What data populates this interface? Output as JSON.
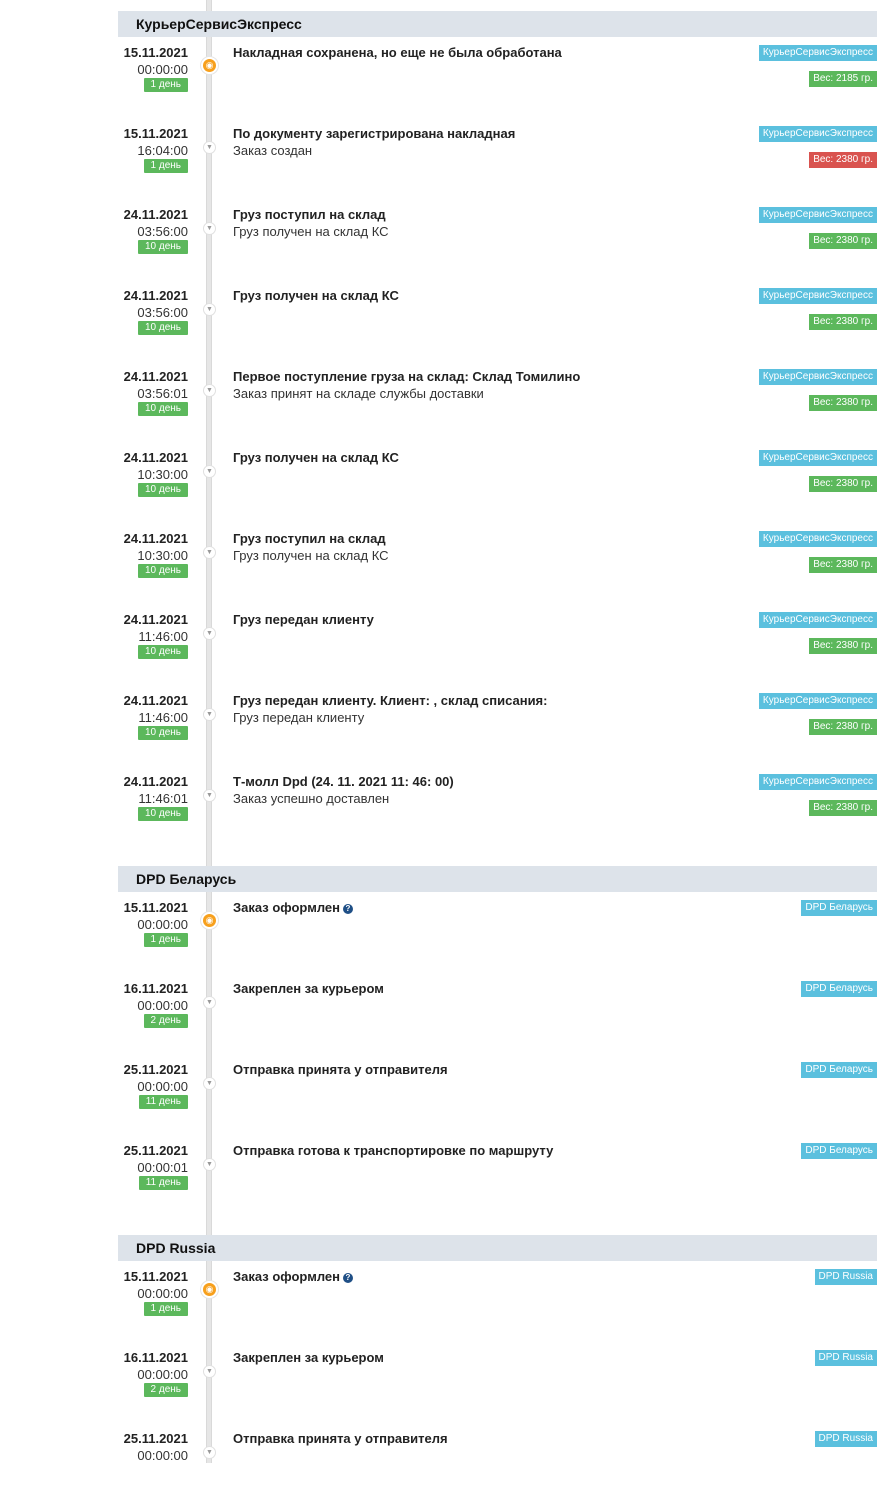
{
  "colors": {
    "days_badge": "#5cb85c",
    "source_badge": "#5bc0de",
    "weight_ok": "#5cb85c",
    "weight_warn": "#d9534f",
    "header_bg": "#dde3ea",
    "marker": "#f7a01d"
  },
  "icons": {
    "first_marker": "package-icon",
    "marker": "chevron-down-icon",
    "help": "question-circle-icon"
  },
  "groups": [
    {
      "title": "КурьерСервисЭкспресс",
      "events": [
        {
          "date": "15.11.2021",
          "time": "00:00:00",
          "days": "1 день",
          "title": "Накладная сохранена, но еще не была обработана",
          "subtitle": "",
          "help": false,
          "source": "КурьерСервисЭкспресс",
          "weight": "Вес: 2185 гр.",
          "weight_status": "ok"
        },
        {
          "date": "15.11.2021",
          "time": "16:04:00",
          "days": "1 день",
          "title": "По документу зарегистрирована накладная",
          "subtitle": "Заказ создан",
          "help": false,
          "source": "КурьерСервисЭкспресс",
          "weight": "Вес: 2380 гр.",
          "weight_status": "warn"
        },
        {
          "date": "24.11.2021",
          "time": "03:56:00",
          "days": "10 день",
          "title": "Груз поступил на склад",
          "subtitle": "Груз получен на склад КС",
          "help": false,
          "source": "КурьерСервисЭкспресс",
          "weight": "Вес: 2380 гр.",
          "weight_status": "ok"
        },
        {
          "date": "24.11.2021",
          "time": "03:56:00",
          "days": "10 день",
          "title": "Груз получен на склад КС",
          "subtitle": "",
          "help": false,
          "source": "КурьерСервисЭкспресс",
          "weight": "Вес: 2380 гр.",
          "weight_status": "ok"
        },
        {
          "date": "24.11.2021",
          "time": "03:56:01",
          "days": "10 день",
          "title": "Первое поступление груза на склад: Склад Томилино",
          "subtitle": "Заказ принят на складе службы доставки",
          "help": false,
          "source": "КурьерСервисЭкспресс",
          "weight": "Вес: 2380 гр.",
          "weight_status": "ok"
        },
        {
          "date": "24.11.2021",
          "time": "10:30:00",
          "days": "10 день",
          "title": "Груз получен на склад КС",
          "subtitle": "",
          "help": false,
          "source": "КурьерСервисЭкспресс",
          "weight": "Вес: 2380 гр.",
          "weight_status": "ok"
        },
        {
          "date": "24.11.2021",
          "time": "10:30:00",
          "days": "10 день",
          "title": "Груз поступил на склад",
          "subtitle": "Груз получен на склад КС",
          "help": false,
          "source": "КурьерСервисЭкспресс",
          "weight": "Вес: 2380 гр.",
          "weight_status": "ok"
        },
        {
          "date": "24.11.2021",
          "time": "11:46:00",
          "days": "10 день",
          "title": "Груз передан клиенту",
          "subtitle": "",
          "help": false,
          "source": "КурьерСервисЭкспресс",
          "weight": "Вес: 2380 гр.",
          "weight_status": "ok"
        },
        {
          "date": "24.11.2021",
          "time": "11:46:00",
          "days": "10 день",
          "title": "Груз передан клиенту. Клиент: , склад списания:",
          "subtitle": "Груз передан клиенту",
          "help": false,
          "source": "КурьерСервисЭкспресс",
          "weight": "Вес: 2380 гр.",
          "weight_status": "ok"
        },
        {
          "date": "24.11.2021",
          "time": "11:46:01",
          "days": "10 день",
          "title": "Т-молл Dpd (24. 11. 2021 11: 46: 00)",
          "subtitle": "Заказ успешно доставлен",
          "help": false,
          "source": "КурьерСервисЭкспресс",
          "weight": "Вес: 2380 гр.",
          "weight_status": "ok"
        }
      ]
    },
    {
      "title": "DPD Беларусь",
      "events": [
        {
          "date": "15.11.2021",
          "time": "00:00:00",
          "days": "1 день",
          "title": "Заказ оформлен",
          "subtitle": "",
          "help": true,
          "source": "DPD Беларусь",
          "weight": "",
          "weight_status": ""
        },
        {
          "date": "16.11.2021",
          "time": "00:00:00",
          "days": "2 день",
          "title": "Закреплен за курьером",
          "subtitle": "",
          "help": false,
          "source": "DPD Беларусь",
          "weight": "",
          "weight_status": ""
        },
        {
          "date": "25.11.2021",
          "time": "00:00:00",
          "days": "11 день",
          "title": "Отправка принята у отправителя",
          "subtitle": "",
          "help": false,
          "source": "DPD Беларусь",
          "weight": "",
          "weight_status": ""
        },
        {
          "date": "25.11.2021",
          "time": "00:00:01",
          "days": "11 день",
          "title": "Отправка готова к транспортировке по маршруту",
          "subtitle": "",
          "help": false,
          "source": "DPD Беларусь",
          "weight": "",
          "weight_status": ""
        }
      ]
    },
    {
      "title": "DPD Russia",
      "events": [
        {
          "date": "15.11.2021",
          "time": "00:00:00",
          "days": "1 день",
          "title": "Заказ оформлен",
          "subtitle": "",
          "help": true,
          "source": "DPD Russia",
          "weight": "",
          "weight_status": ""
        },
        {
          "date": "16.11.2021",
          "time": "00:00:00",
          "days": "2 день",
          "title": "Закреплен за курьером",
          "subtitle": "",
          "help": false,
          "source": "DPD Russia",
          "weight": "",
          "weight_status": ""
        },
        {
          "date": "25.11.2021",
          "time": "00:00:00",
          "days": "",
          "title": "Отправка принята у отправителя",
          "subtitle": "",
          "help": false,
          "source": "DPD Russia",
          "weight": "",
          "weight_status": ""
        }
      ]
    }
  ]
}
